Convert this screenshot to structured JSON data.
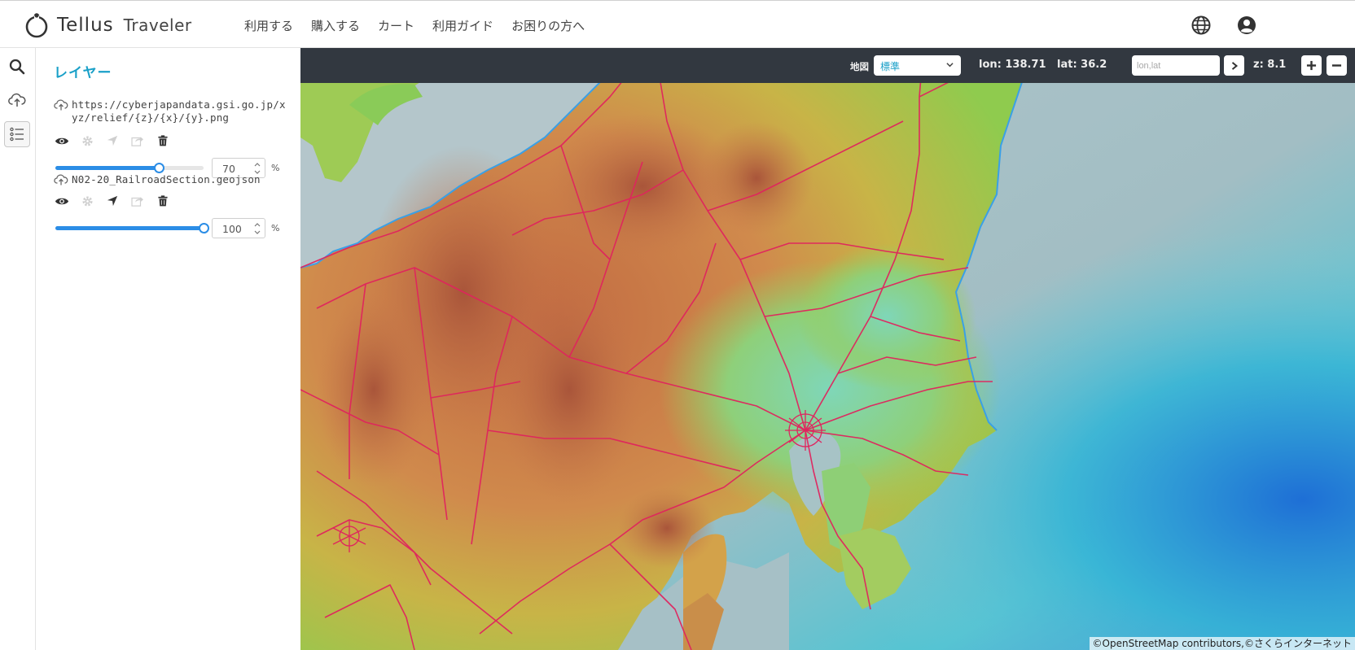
{
  "header": {
    "logo_name": "Tellus",
    "logo_sub": "Traveler",
    "nav": [
      "利用する",
      "購入する",
      "カート",
      "利用ガイド",
      "お困りの方へ"
    ],
    "language_icon": "globe-icon",
    "account_icon": "user-circle-icon"
  },
  "rail": {
    "items": [
      {
        "icon": "search-icon",
        "active": false
      },
      {
        "icon": "cloud-upload-icon",
        "active": false
      },
      {
        "icon": "layer-list-icon",
        "active": true
      }
    ]
  },
  "panel": {
    "title": "レイヤー",
    "layers": [
      {
        "name": "https://cyberjapandata.gsi.go.jp/xyz/relief/{z}/{x}/{y}.png",
        "opacity": "70",
        "opacity_fraction": 0.7,
        "unit": "%",
        "tools": [
          {
            "icon": "eye-icon",
            "enabled": true
          },
          {
            "icon": "gear-icon",
            "enabled": false
          },
          {
            "icon": "locate-arrow-icon",
            "enabled": false
          },
          {
            "icon": "share-icon",
            "enabled": false
          },
          {
            "icon": "trash-icon",
            "enabled": true
          }
        ]
      },
      {
        "name": "N02-20_RailroadSection.geojson",
        "opacity": "100",
        "opacity_fraction": 1.0,
        "unit": "%",
        "tools": [
          {
            "icon": "eye-icon",
            "enabled": true
          },
          {
            "icon": "gear-icon",
            "enabled": false
          },
          {
            "icon": "locate-arrow-icon",
            "enabled": true
          },
          {
            "icon": "share-icon",
            "enabled": false
          },
          {
            "icon": "trash-icon",
            "enabled": true
          }
        ]
      }
    ]
  },
  "toolbar": {
    "map_label": "地図",
    "map_select_value": "標準",
    "lon_text": "lon: 138.71",
    "lat_text": "lat: 36.2",
    "coord_placeholder": "lon,lat",
    "zoom_text": "z: 8.1"
  },
  "map": {
    "attribution": "©OpenStreetMap contributors,©さくらインターネット",
    "rail_color": "#e0245e"
  },
  "colors": {
    "accent": "#1aa0c8",
    "slider": "#2b8de6",
    "toolbar_bg": "#323840"
  }
}
